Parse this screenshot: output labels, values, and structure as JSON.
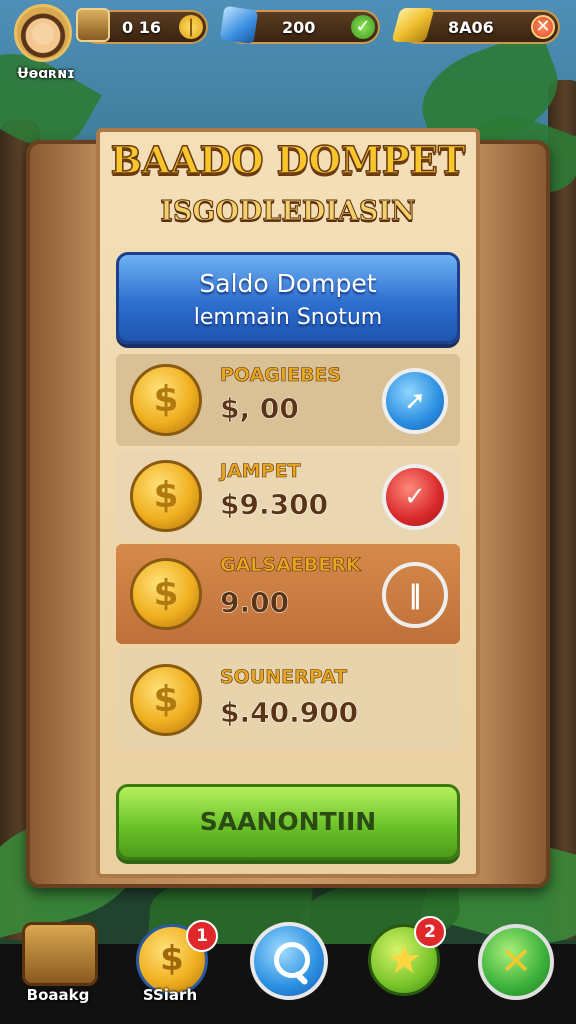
{
  "hud": {
    "player_name": "Ʉɵɑʀɴɪ",
    "resources": [
      {
        "icon": "chest-coin-icon",
        "value": "0 16"
      },
      {
        "icon": "blue-gem-icon",
        "value": "200"
      },
      {
        "icon": "gold-bar-icon",
        "value": "8A06"
      }
    ]
  },
  "panel": {
    "title": "BAADO DOMPET",
    "subtitle": "ISGODLEDIASIN",
    "balance_button": {
      "line1": "Saldo Dompet",
      "line2": "lemmain Snotum"
    },
    "rows": [
      {
        "label": "POAGIEBES",
        "value": "$, 00",
        "icon": "coin-dollar-icon",
        "action_icon": "blue-arrow-icon"
      },
      {
        "label": "JAMPET",
        "value": "$9.300",
        "icon": "coin-dollar-icon",
        "action_icon": "red-check-icon"
      },
      {
        "label": "GALSAEBERK",
        "value": "9.00",
        "icon": "coin-dollar-icon",
        "action_icon": "blue-bar-icon"
      },
      {
        "label": "SOUNERPAT",
        "value": "$.40.900",
        "icon": "coin-dollar-icon",
        "action_icon": ""
      }
    ],
    "confirm_label": "SAANONTIIN"
  },
  "nav": {
    "items": [
      {
        "label": "Boaakg",
        "icon": "treasure-chest-icon",
        "badge": ""
      },
      {
        "label": "SSiarh",
        "icon": "coin-dollar-icon",
        "badge": "1"
      },
      {
        "label": "",
        "icon": "search-icon",
        "badge": ""
      },
      {
        "label": "",
        "icon": "star-icon",
        "badge": "2"
      },
      {
        "label": "",
        "icon": "close-icon",
        "badge": ""
      }
    ]
  },
  "colors": {
    "accent_gold": "#f6c62c",
    "button_blue": "#2e6fd0",
    "button_green": "#6cc42a",
    "highlight_row": "#d58a4a",
    "close_red": "#e04a2a"
  }
}
